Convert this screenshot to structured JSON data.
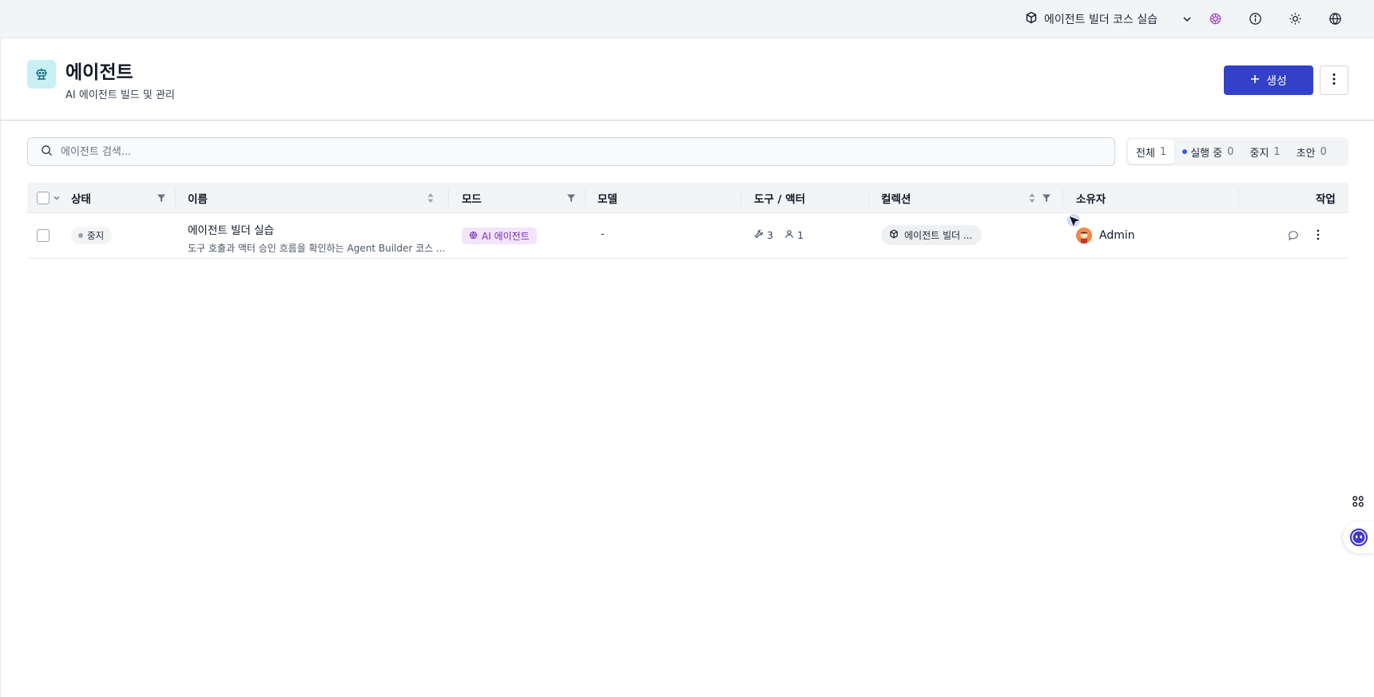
{
  "topbar": {
    "collection_label": "에이전트 빌더 코스 실습",
    "icons": [
      "cube-icon",
      "chevron-down-icon",
      "brain-icon",
      "info-icon",
      "sun-icon",
      "globe-icon"
    ]
  },
  "header": {
    "title": "에이전트",
    "subtitle": "AI 에이전트 빌드 및 관리",
    "create_label": "생성",
    "icon": "robot-icon"
  },
  "search": {
    "placeholder": "에이전트 검색..."
  },
  "filter_tabs": [
    {
      "label": "전체",
      "count": "1",
      "active": true
    },
    {
      "label": "실행 중",
      "count": "0",
      "active": false
    },
    {
      "label": "중지",
      "count": "1",
      "active": false
    },
    {
      "label": "초안",
      "count": "0",
      "active": false
    }
  ],
  "table": {
    "columns": {
      "status": "상태",
      "name": "이름",
      "mode": "모드",
      "model": "모델",
      "tools": "도구 / 액터",
      "collection": "컬렉션",
      "owner": "소유자",
      "actions": "작업"
    },
    "rows": [
      {
        "status": "중지",
        "name": "에이전트 빌더 실습",
        "description": "도구 호출과 액터 승인 흐름을 확인하는 Agent Builder 코스 ...",
        "mode": "AI 에이전트",
        "model": "-",
        "tools_count": "3",
        "actors_count": "1",
        "collection": "에이전트 빌더 ...",
        "owner": "Admin"
      }
    ]
  },
  "colors": {
    "primary": "#3341c9",
    "mode_badge_bg": "#f1e4fb",
    "mode_badge_text": "#7b2fb5",
    "app_icon_bg": "#c9f0f4",
    "running_dot": "#3b5bdb"
  }
}
